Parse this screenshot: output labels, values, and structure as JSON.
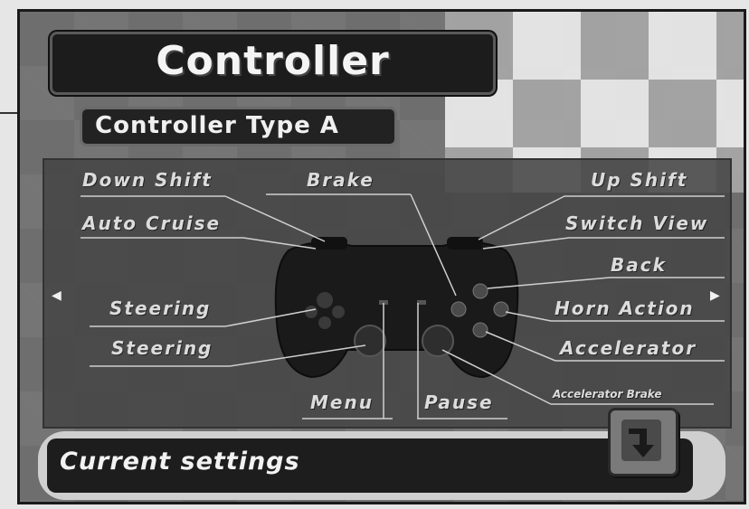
{
  "header": {
    "title": "Controller"
  },
  "controller_type": {
    "label": "Controller Type A"
  },
  "mapping": {
    "down_shift": "Down Shift",
    "brake": "Brake",
    "up_shift": "Up Shift",
    "auto_cruise": "Auto Cruise",
    "switch_view": "Switch View",
    "back": "Back",
    "steering_1": "Steering",
    "horn_action": "Horn  Action",
    "steering_2": "Steering",
    "accelerator": "Accelerator",
    "menu": "Menu",
    "pause": "Pause",
    "accelerator_brake": "Accelerator  Brake"
  },
  "nav": {
    "left_arrow": "◀",
    "right_arrow": "▶"
  },
  "footer": {
    "status": "Current settings",
    "return_icon": "return-arrow-icon"
  }
}
